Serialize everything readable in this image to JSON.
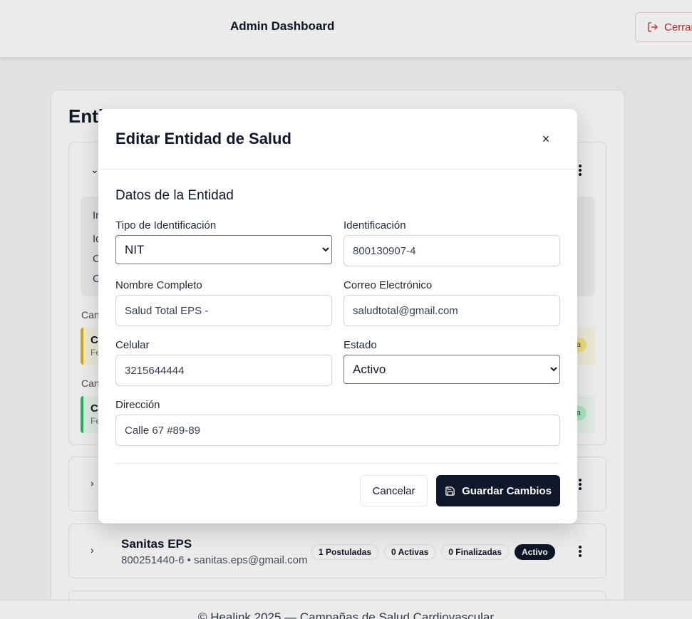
{
  "header": {
    "title": "Admin Dashboard",
    "logout_label": "Cerrar"
  },
  "panel": {
    "title": "Enti"
  },
  "card1": {
    "info_fragments": [
      "In",
      "Id",
      "C",
      "C"
    ],
    "campaign_labels": [
      "Can",
      "Can"
    ],
    "campaign_titles": [
      "Ca",
      "Ca"
    ],
    "campaign_subtitles": [
      "Fe",
      "Fe"
    ],
    "campaign_pills": [
      "a",
      "a"
    ]
  },
  "card3": {
    "name": "Sanitas EPS",
    "subtitle": "800251440-6 • sanitas.eps@gmail.com",
    "badges": [
      "1 Postuladas",
      "0 Activas",
      "0 Finalizadas"
    ],
    "status": "Activo"
  },
  "footer": {
    "text": "© Healink 2025 — Campañas de Salud Cardiovascular"
  },
  "modal": {
    "title": "Editar Entidad de Salud",
    "close_symbol": "×",
    "section_title": "Datos de la Entidad",
    "fields": {
      "tipo": {
        "label": "Tipo de Identificación",
        "value": "NIT"
      },
      "identificacion": {
        "label": "Identificación",
        "value": "800130907-4"
      },
      "nombre": {
        "label": "Nombre Completo",
        "value": "Salud Total EPS -"
      },
      "correo": {
        "label": "Correo Electrónico",
        "value": "saludtotal@gmail.com"
      },
      "celular": {
        "label": "Celular",
        "value": "3215644444"
      },
      "estado": {
        "label": "Estado",
        "value": "Activo"
      },
      "direccion": {
        "label": "Dirección",
        "value": "Calle 67 #89-89"
      }
    },
    "cancel_label": "Cancelar",
    "save_label": "Guardar Cambios"
  }
}
